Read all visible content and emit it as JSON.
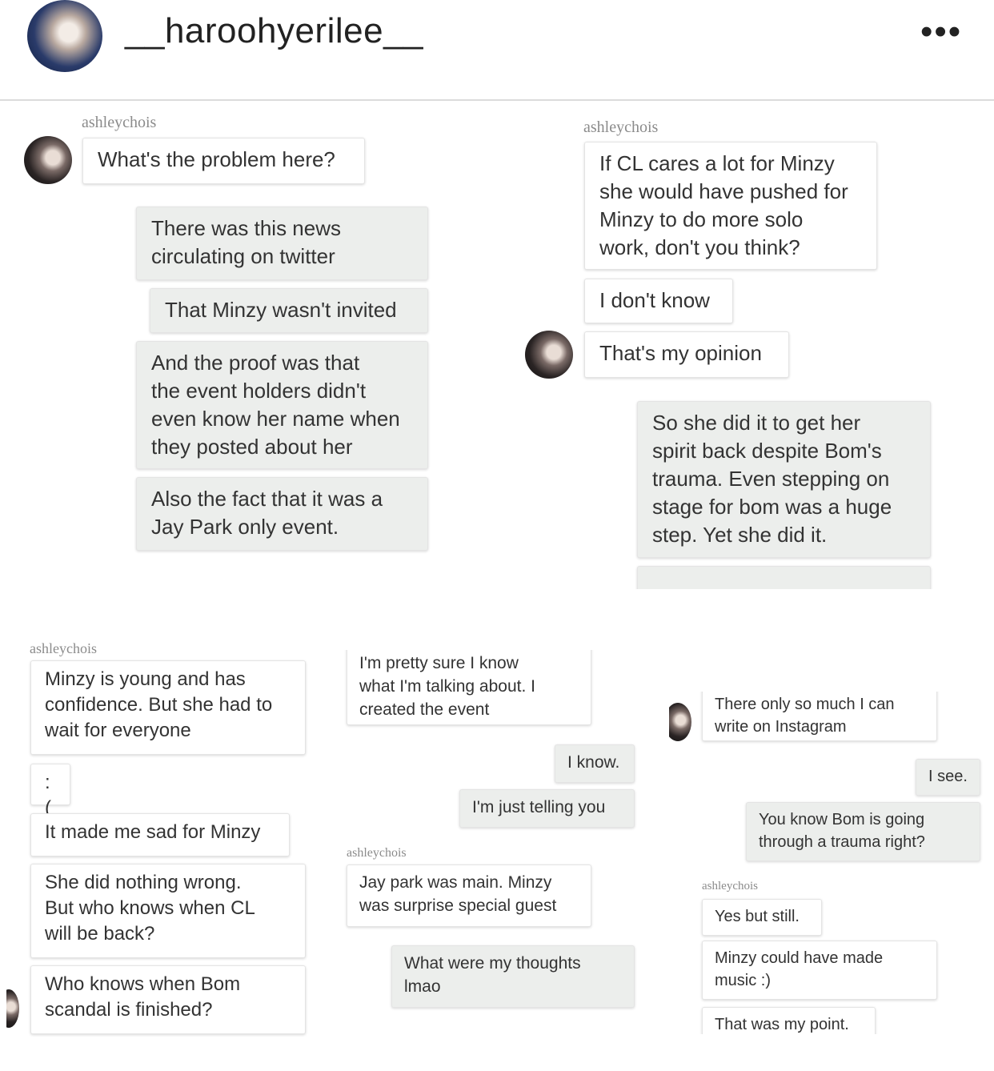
{
  "header": {
    "username": "__haroohyerilee__",
    "more_glyph": "•••"
  },
  "panel1": {
    "sender": "ashleychois",
    "messages": [
      "What's the problem here?",
      "There was this news\ncirculating on twitter",
      "That Minzy wasn't invited",
      "And the proof was that\nthe event holders didn't\neven know her name when\nthey posted about her",
      "Also the fact that it was a\nJay Park only event."
    ]
  },
  "panel2": {
    "sender": "ashleychois",
    "messages": [
      "If CL cares a lot for Minzy\nshe would have pushed for\nMinzy to do more solo\nwork, don't you think?",
      "I don't know",
      "That's my opinion",
      "So she did it to get her\nspirit back despite Bom's\ntrauma. Even stepping on\nstage for bom was a  huge\nstep. Yet she did it."
    ]
  },
  "panel3": {
    "sender": "ashleychois",
    "messages": [
      "Minzy is young and has\nconfidence. But she had to\nwait for everyone",
      ":(",
      "It made me sad for Minzy",
      "She did nothing wrong.\nBut who knows when CL\nwill be back?",
      "Who knows when Bom\nscandal is finished?"
    ]
  },
  "panel4": {
    "sender": "ashleychois",
    "messages": [
      "I'm pretty sure I know\nwhat I'm talking about. I\ncreated the event",
      "I know.",
      "I'm just telling you",
      "Jay park was main. Minzy\nwas surprise special guest",
      "What were my thoughts\nlmao"
    ]
  },
  "panel5": {
    "sender": "ashleychois",
    "messages": [
      "There only so much I can\nwrite on Instagram",
      "I see.",
      "You know Bom is going\nthrough a trauma right?",
      "Yes but still.",
      "Minzy could have made\nmusic :)",
      "That was my point."
    ]
  }
}
